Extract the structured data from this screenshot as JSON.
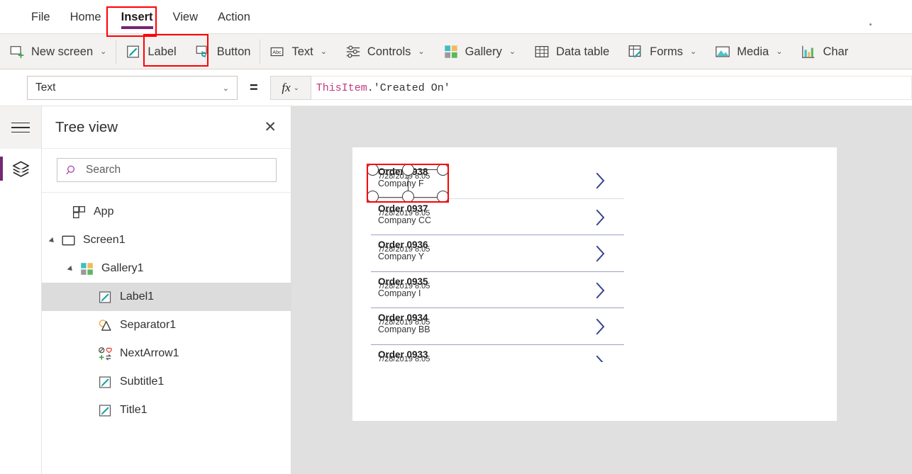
{
  "menubar": {
    "items": [
      {
        "label": "File",
        "active": false
      },
      {
        "label": "Home",
        "active": false
      },
      {
        "label": "Insert",
        "active": true
      },
      {
        "label": "View",
        "active": false
      },
      {
        "label": "Action",
        "active": false
      }
    ],
    "accent_color": "#742774"
  },
  "ribbon": {
    "items": [
      {
        "label": "New screen",
        "icon": "new-screen-icon",
        "chevron": true
      },
      {
        "label": "Label",
        "icon": "label-icon",
        "chevron": false
      },
      {
        "label": "Button",
        "icon": "button-icon",
        "chevron": false
      },
      {
        "label": "Text",
        "icon": "text-icon",
        "chevron": true
      },
      {
        "label": "Controls",
        "icon": "controls-icon",
        "chevron": true
      },
      {
        "label": "Gallery",
        "icon": "gallery-icon",
        "chevron": true
      },
      {
        "label": "Data table",
        "icon": "data-table-icon",
        "chevron": false
      },
      {
        "label": "Forms",
        "icon": "forms-icon",
        "chevron": true
      },
      {
        "label": "Media",
        "icon": "media-icon",
        "chevron": true
      },
      {
        "label": "Char",
        "icon": "charts-icon",
        "chevron": false
      }
    ],
    "chevron_glyph": "⌄"
  },
  "formula_bar": {
    "property": "Text",
    "equals": "=",
    "fx_label": "fx",
    "fx_chevron": "⌄",
    "formula_object": "ThisItem",
    "formula_punct": ".",
    "formula_field": "'Created On'",
    "object_color": "#c4377f"
  },
  "rail": {
    "hamburger_name": "hamburger-menu",
    "layers_name": "layers-icon",
    "active_accent": "#742774"
  },
  "treeview": {
    "title": "Tree view",
    "close_glyph": "✕",
    "search_placeholder": "Search",
    "items": [
      {
        "label": "App",
        "icon": "app-icon",
        "indent": 0,
        "caret": false,
        "selected": false
      },
      {
        "label": "Screen1",
        "icon": "screen-icon",
        "indent": 0,
        "caret": true,
        "selected": false
      },
      {
        "label": "Gallery1",
        "icon": "gallery-icon",
        "indent": 1,
        "caret": true,
        "selected": false
      },
      {
        "label": "Label1",
        "icon": "label-icon",
        "indent": 2,
        "caret": false,
        "selected": true
      },
      {
        "label": "Separator1",
        "icon": "shapes-icon",
        "indent": 2,
        "caret": false,
        "selected": false
      },
      {
        "label": "NextArrow1",
        "icon": "icons-icon",
        "indent": 2,
        "caret": false,
        "selected": false
      },
      {
        "label": "Subtitle1",
        "icon": "label-icon",
        "indent": 2,
        "caret": false,
        "selected": false
      },
      {
        "label": "Title1",
        "icon": "label-icon",
        "indent": 2,
        "caret": false,
        "selected": false
      }
    ]
  },
  "canvas": {
    "background": "#e0e0e0",
    "screen_background": "#ffffff",
    "gallery": {
      "rows": [
        {
          "title": "Order 0938",
          "subtitle": "Company F",
          "date": "7/28/2019 8:05",
          "selected": true,
          "arrow": true,
          "clipped": false
        },
        {
          "title": "Order 0937",
          "subtitle": "Company CC",
          "date": "7/28/2019 8:05",
          "selected": false,
          "arrow": true,
          "clipped": false
        },
        {
          "title": "Order 0936",
          "subtitle": "Company Y",
          "date": "7/28/2019 8:05",
          "selected": false,
          "arrow": true,
          "clipped": false
        },
        {
          "title": "Order 0935",
          "subtitle": "Company I",
          "date": "7/28/2019 8:05",
          "selected": false,
          "arrow": true,
          "clipped": false
        },
        {
          "title": "Order 0934",
          "subtitle": "Company BB",
          "date": "7/28/2019 8:05",
          "selected": false,
          "arrow": true,
          "clipped": false
        },
        {
          "title": "Order 0933",
          "subtitle": "",
          "date": "7/28/2019 8:05",
          "selected": false,
          "arrow": true,
          "clipped": true
        }
      ],
      "arrow_color": "#33408a",
      "separator_color": "#9da3c4"
    }
  },
  "annotations": {
    "color": "#ff0000",
    "boxes": [
      "insert-tab",
      "label-ribbon-button",
      "selected-gallery-label"
    ]
  }
}
